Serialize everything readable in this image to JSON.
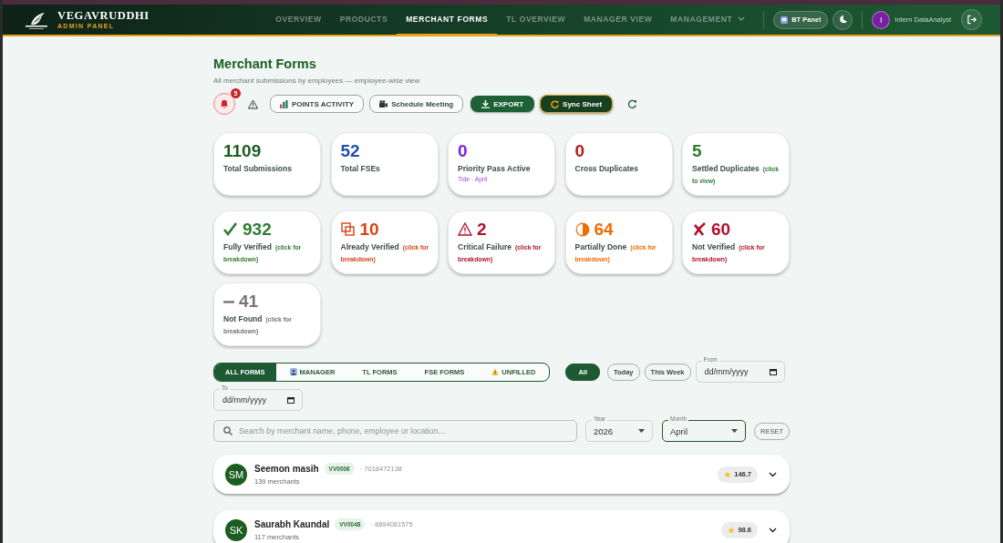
{
  "header": {
    "brand": "VEGAVRUDDHI",
    "subtitle": "ADMIN PANEL",
    "nav": [
      {
        "label": "OVERVIEW",
        "selected": false,
        "dropdown": false
      },
      {
        "label": "PRODUCTS",
        "selected": false,
        "dropdown": false
      },
      {
        "label": "MERCHANT FORMS",
        "selected": true,
        "dropdown": false
      },
      {
        "label": "TL OVERVIEW",
        "selected": false,
        "dropdown": false
      },
      {
        "label": "MANAGER VIEW",
        "selected": false,
        "dropdown": false
      },
      {
        "label": "MANAGEMENT",
        "selected": false,
        "dropdown": true
      }
    ],
    "bt_panel": "BT Panel",
    "user": {
      "initial": "I",
      "name": "Intern DataAnalyst"
    }
  },
  "page": {
    "title": "Merchant Forms",
    "subtitle": "All merchant submissions by employees — employee-wise view"
  },
  "toolbar": {
    "notification_count": "5",
    "buttons": [
      {
        "label": "POINTS ACTIVITY",
        "kind": "points"
      },
      {
        "label": "Schedule Meeting",
        "kind": "meeting"
      },
      {
        "label": "EXPORT",
        "kind": "export"
      },
      {
        "label": "Sync Sheet",
        "kind": "sync"
      }
    ]
  },
  "stats": [
    {
      "kind": "plain",
      "value": "1109",
      "label": "Total Submissions",
      "color": "#1b5e20"
    },
    {
      "kind": "plain",
      "value": "52",
      "label": "Total FSEs",
      "color": "#1e4fb0"
    },
    {
      "kind": "plain",
      "value": "0",
      "label": "Priority Pass Active",
      "note": "Tide · April",
      "color": "#7b1fe8"
    },
    {
      "kind": "plain",
      "value": "0",
      "label": "Cross Duplicates",
      "color": "#b71c1c"
    },
    {
      "kind": "plain",
      "value": "5",
      "label": "Settled Duplicates",
      "hint": "(click to view)",
      "color": "#2e7d32"
    },
    {
      "kind": "check",
      "value": "932",
      "label": "Fully Verified",
      "hint": "(click for breakdown)",
      "color": "#2e7d32"
    },
    {
      "kind": "copy",
      "value": "10",
      "label": "Already Verified",
      "hint": "(click for breakdown)",
      "color": "#d84315"
    },
    {
      "kind": "warning",
      "value": "2",
      "label": "Critical Failure",
      "hint": "(click for breakdown)",
      "color": "#b0122a"
    },
    {
      "kind": "half",
      "value": "64",
      "label": "Partially Done",
      "hint": "(click for breakdown)",
      "color": "#ef6c00"
    },
    {
      "kind": "cross",
      "value": "60",
      "label": "Not Verified",
      "hint": "(click for breakdown)",
      "color": "#b0122a"
    },
    {
      "kind": "dash",
      "value": "41",
      "label": "Not Found",
      "hint": "(click for breakdown)",
      "color": "#757575"
    }
  ],
  "form_tabs": [
    {
      "label": "ALL FORMS",
      "kind": "plain",
      "selected": true
    },
    {
      "label": "MANAGER",
      "kind": "person",
      "selected": false
    },
    {
      "label": "TL FORMS",
      "kind": "plain",
      "selected": false
    },
    {
      "label": "FSE FORMS",
      "kind": "plain",
      "selected": false
    },
    {
      "label": "UNFILLED",
      "kind": "warning",
      "selected": false
    }
  ],
  "date_filters": [
    {
      "label": "All",
      "selected": true
    },
    {
      "label": "Today",
      "selected": false
    },
    {
      "label": "This Week",
      "selected": false
    }
  ],
  "date_fields": [
    {
      "label": "From",
      "placeholder": "dd/mm/yyyy"
    },
    {
      "label": "To",
      "placeholder": "dd/mm/yyyy"
    }
  ],
  "search": {
    "placeholder": "Search by merchant name, phone, employee or location…"
  },
  "selects": [
    {
      "label": "Year",
      "value": "2026",
      "focused": false
    },
    {
      "label": "Month",
      "value": "April",
      "focused": true
    }
  ],
  "reset": "RESET",
  "employees": [
    {
      "initials": "SM",
      "name": "Seemon masih",
      "code": "VV0006",
      "phone": "· 7018472138",
      "merchants": "139 merchants",
      "points": "146.7"
    },
    {
      "initials": "SK",
      "name": "Saurabh Kaundal",
      "code": "VV0048",
      "phone": "· 8894081575",
      "merchants": "117 merchants",
      "points": "98.6"
    }
  ]
}
